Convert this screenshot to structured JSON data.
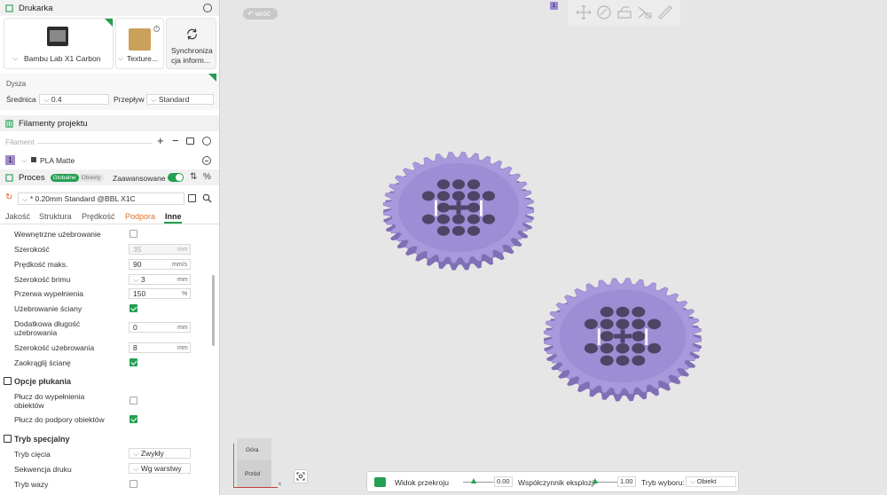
{
  "printer": {
    "header": "Drukarka",
    "machine": "Bambu Lab X1 Carbon",
    "plate": "Texture...",
    "sync_line1": "Synchroniza",
    "sync_line2": "cja inform..."
  },
  "nozzle": {
    "label": "Dysza",
    "diameter_label": "Średnica",
    "diameter_value": "0.4",
    "flow_label": "Przepływ",
    "flow_value": "Standard"
  },
  "filaments": {
    "header": "Filamenty projektu",
    "field_label": "Filament",
    "slot_number": "1",
    "slot_name": "PLA Matte",
    "slot_color": "#a08ccd"
  },
  "process": {
    "header": "Proces",
    "global_label": "Globalne",
    "objects_label": "Obiekty",
    "advanced_label": "Zaawansowane",
    "profile": "* 0.20mm Standard @BBL X1C",
    "tabs": [
      "Jakość",
      "Struktura",
      "Prędkość",
      "Podpora",
      "Inne"
    ]
  },
  "settings": {
    "inner_rib": "Wewnętrzne użebrowanie",
    "width_label": "Szerokość",
    "width_value": "35",
    "width_unit": "mm",
    "max_speed_label": "Prędkość maks.",
    "max_speed_value": "90",
    "max_speed_unit": "mm/s",
    "brim_label": "Szerokość brimu",
    "brim_value": "3",
    "brim_unit": "mm",
    "infill_gap_label": "Przerwa wypełnienia",
    "infill_gap_value": "150",
    "infill_gap_unit": "%",
    "wall_rib_label": "Użebrowanie ściany",
    "extra_len_line1": "Dodatkowa długość",
    "extra_len_line2": "użebrowania",
    "extra_len_value": "0",
    "extra_len_unit": "mm",
    "rib_width_label": "Szerokość użebrowania",
    "rib_width_value": "8",
    "rib_width_unit": "mm",
    "round_wall_label": "Zaokrąglij ścianę",
    "flush_header": "Opcje płukania",
    "flush_infill_line1": "Płucz do wypełnienia",
    "flush_infill_line2": "obiektów",
    "flush_support_label": "Płucz do podpory obiektów",
    "special_header": "Tryb specjalny",
    "slicing_mode_label": "Tryb cięcia",
    "slicing_mode_value": "Zwykły",
    "print_seq_label": "Sekwencja druku",
    "print_seq_value": "Wg warstwy",
    "vase_label": "Tryb wazy"
  },
  "viewport": {
    "back_label": "wróć",
    "plate_badge": "1",
    "cube_top": "Góra",
    "cube_front": "Przód",
    "axis_x": "x",
    "model_color": "#a899dc"
  },
  "bottom_bar": {
    "section_label": "Widok przekroju",
    "section_value": "0.00",
    "explode_label": "Współczynnik eksplozji",
    "explode_value": "1.00",
    "select_label": "Tryb wyboru:",
    "select_value": "Obiekt"
  }
}
